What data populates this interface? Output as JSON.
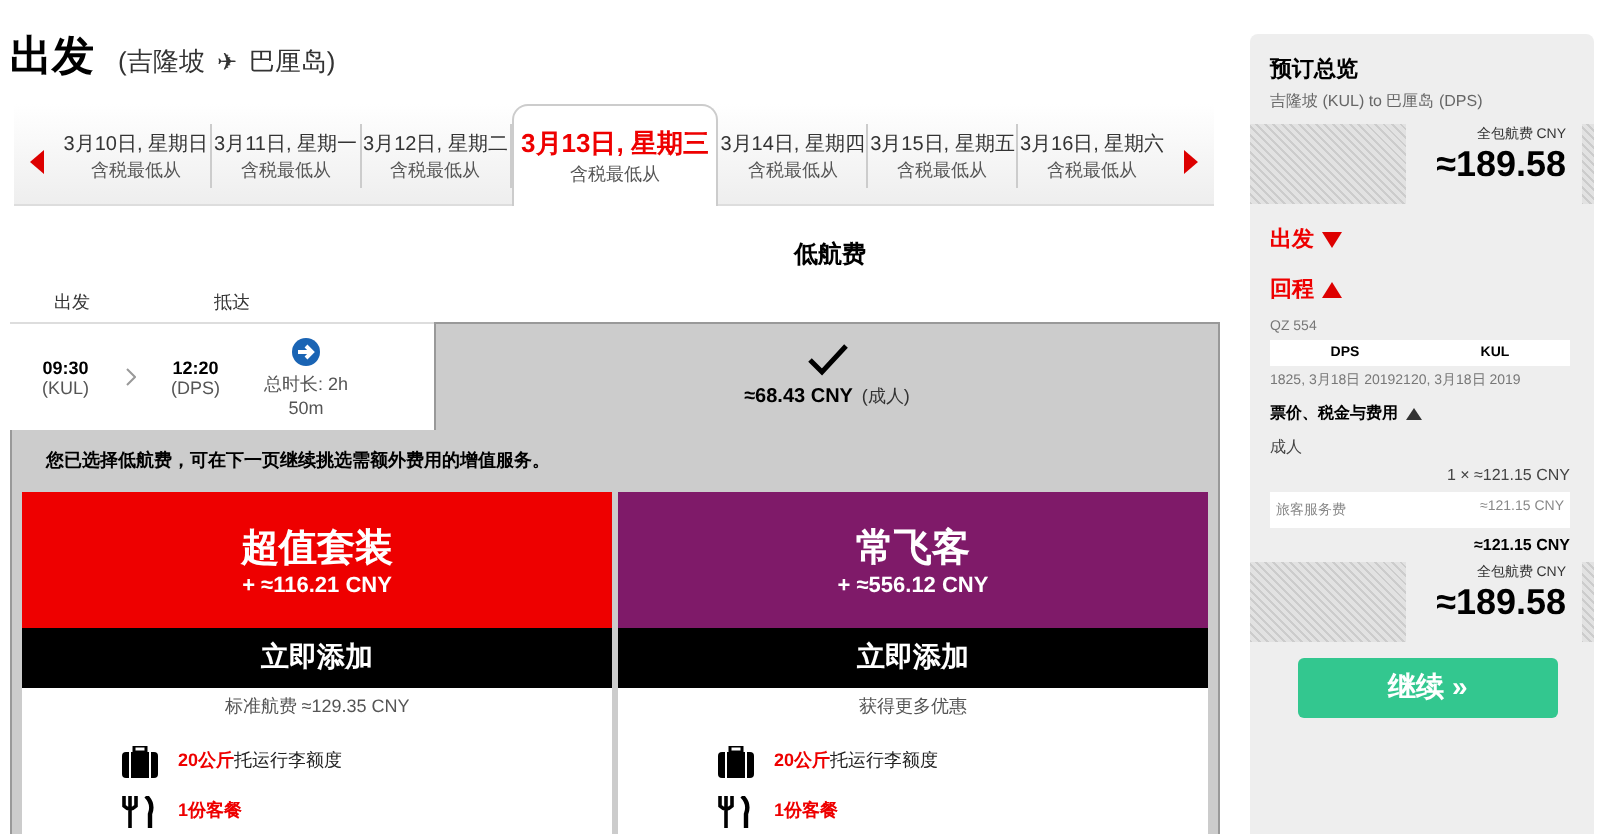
{
  "heading": {
    "title": "出发",
    "from": "(吉隆坡",
    "plane": "✈",
    "to": "巴厘岛)"
  },
  "dates": [
    {
      "date": "3月10日, 星期日",
      "note": "含税最低从",
      "selected": false
    },
    {
      "date": "3月11日, 星期一",
      "note": "含税最低从",
      "selected": false
    },
    {
      "date": "3月12日, 星期二",
      "note": "含税最低从",
      "selected": false
    },
    {
      "date": "3月13日, 星期三",
      "note": "含税最低从",
      "selected": true
    },
    {
      "date": "3月14日, 星期四",
      "note": "含税最低从",
      "selected": false
    },
    {
      "date": "3月15日, 星期五",
      "note": "含税最低从",
      "selected": false
    },
    {
      "date": "3月16日, 星期六",
      "note": "含税最低从",
      "selected": false
    }
  ],
  "fare_title": "低航费",
  "columns": [
    "出发",
    "抵达"
  ],
  "flight": {
    "depart_time": "09:30",
    "depart_code": "(KUL)",
    "arrive_time": "12:20",
    "arrive_code": "(DPS)",
    "duration": "总时长: 2h 50m",
    "fare": "≈68.43 CNY",
    "fare_note": "(成人)",
    "selected": true
  },
  "notice": "您已选择低航费，可在下一页继续挑选需额外费用的增值服务。",
  "bundles": [
    {
      "name": "超值套装",
      "price": "+ ≈116.21 CNY",
      "color": "#ee0000",
      "button": "立即添加",
      "note": "标准航费 ≈129.35 CNY",
      "features": [
        {
          "kind": "baggage",
          "highlight": "20公斤",
          "text": "托运行李额度"
        },
        {
          "kind": "meal",
          "highlight": "1份客餐"
        }
      ]
    },
    {
      "name": "常飞客",
      "price": "+ ≈556.12 CNY",
      "color": "#7f1a69",
      "button": "立即添加",
      "note": "获得更多优惠",
      "features": [
        {
          "kind": "baggage",
          "highlight": "20公斤",
          "text": "托运行李额度"
        },
        {
          "kind": "meal",
          "highlight": "1份客餐"
        }
      ]
    }
  ],
  "summary": {
    "title": "预订总览",
    "route": "吉隆坡 (KUL) to 巴厘岛 (DPS)",
    "total_label": "全包航费 CNY",
    "total": "≈189.58",
    "legs": [
      {
        "label": "出发",
        "expanded": false
      },
      {
        "label": "回程",
        "expanded": true
      }
    ],
    "flight_no": "QZ 554",
    "from": "DPS",
    "to": "KUL",
    "times": "1825, 3月18日 20192120, 3月18日 2019",
    "fees_title": "票价、税金与费用",
    "fees_expanded": true,
    "passenger": "成人",
    "passenger_fare": "1 × ≈121.15 CNY",
    "fee_name": "旅客服务费",
    "fee_value": "≈121.15 CNY",
    "subtotal": "≈121.15 CNY",
    "total_label_2": "全包航费 CNY",
    "total_2": "≈189.58",
    "continue": "继续 »"
  }
}
